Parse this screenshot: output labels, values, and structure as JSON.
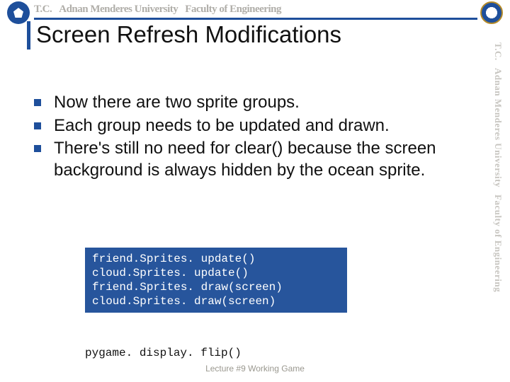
{
  "header": {
    "tc": "T.C.",
    "university": "Adnan Menderes University",
    "faculty": "Faculty of Engineering"
  },
  "title": "Screen Refresh Modifications",
  "bullets": [
    "Now there are two sprite groups.",
    "Each group needs to be updated and drawn.",
    "There's still no need for clear() because the screen background is always hidden by the ocean sprite."
  ],
  "code": {
    "lines": "friend.Sprites. update()\ncloud.Sprites. update()\nfriend.Sprites. draw(screen)\ncloud.Sprites. draw(screen)",
    "flip": "pygame. display. flip()"
  },
  "sidebar": {
    "tc": "T.C.",
    "university": "Adnan Menderes University",
    "faculty": "Faculty of Engineering"
  },
  "footer": "Lecture #9 Working Game"
}
